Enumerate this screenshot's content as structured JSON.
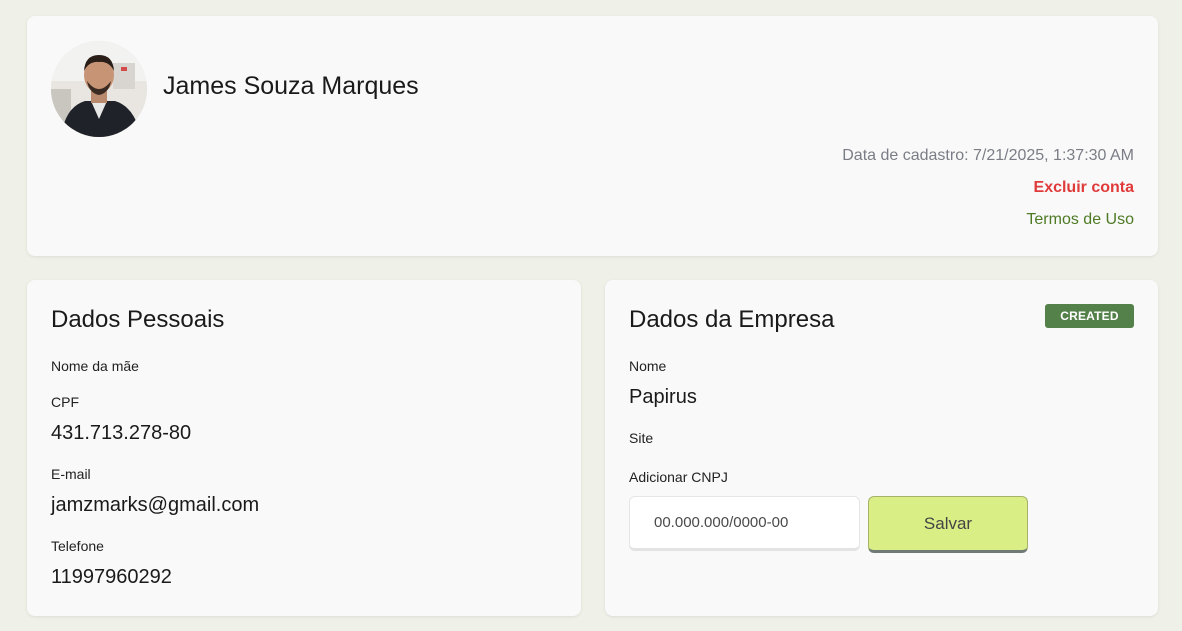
{
  "profile": {
    "name": "James Souza Marques",
    "registration_date": "Data de cadastro: 7/21/2025, 1:37:30 AM",
    "delete_account_label": "Excluir conta",
    "terms_label": "Termos de Uso"
  },
  "personal": {
    "title": "Dados Pessoais",
    "mother_name_label": "Nome da mãe",
    "mother_name_value": "",
    "cpf_label": "CPF",
    "cpf_value": "431.713.278-80",
    "email_label": "E-mail",
    "email_value": "jamzmarks@gmail.com",
    "phone_label": "Telefone",
    "phone_value": "11997960292"
  },
  "company": {
    "title": "Dados da Empresa",
    "status": "CREATED",
    "name_label": "Nome",
    "name_value": "Papirus",
    "site_label": "Site",
    "site_value": "",
    "cnpj_label": "Adicionar CNPJ",
    "cnpj_placeholder": "00.000.000/0000-00",
    "cnpj_value": "",
    "save_label": "Salvar"
  },
  "colors": {
    "background": "#eff0e7",
    "card": "#f9f9f9",
    "danger": "#e03b3b",
    "link": "#4e7a25",
    "badge": "#54804a",
    "save_button": "#d9ef86"
  }
}
